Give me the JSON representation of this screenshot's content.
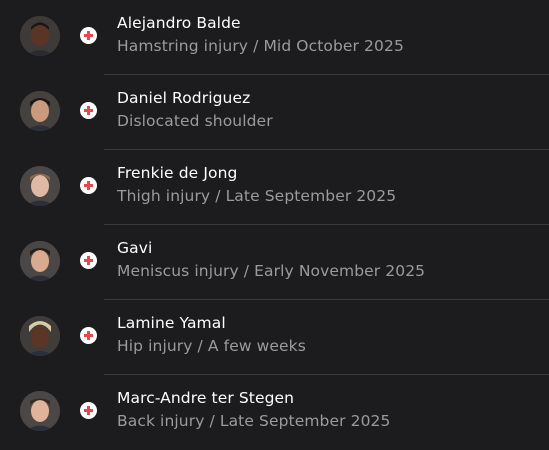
{
  "colors": {
    "background": "#1c1c1e",
    "name_text": "#ffffff",
    "detail_text": "#9b9b9f",
    "divider": "#3a3a3c",
    "injury_cross": "#e5484d"
  },
  "players": [
    {
      "name": "Alejandro Balde",
      "detail": "Hamstring injury / Mid October 2025",
      "avatar_icon": "player-photo",
      "status_icon": "injury-cross-icon"
    },
    {
      "name": "Daniel Rodriguez",
      "detail": "Dislocated shoulder",
      "avatar_icon": "player-photo",
      "status_icon": "injury-cross-icon"
    },
    {
      "name": "Frenkie de Jong",
      "detail": "Thigh injury / Late September 2025",
      "avatar_icon": "player-photo",
      "status_icon": "injury-cross-icon"
    },
    {
      "name": "Gavi",
      "detail": "Meniscus injury / Early November 2025",
      "avatar_icon": "player-photo",
      "status_icon": "injury-cross-icon"
    },
    {
      "name": "Lamine Yamal",
      "detail": "Hip injury / A few weeks",
      "avatar_icon": "player-photo",
      "status_icon": "injury-cross-icon"
    },
    {
      "name": "Marc-Andre ter Stegen",
      "detail": "Back injury / Late September 2025",
      "avatar_icon": "player-photo",
      "status_icon": "injury-cross-icon"
    }
  ]
}
